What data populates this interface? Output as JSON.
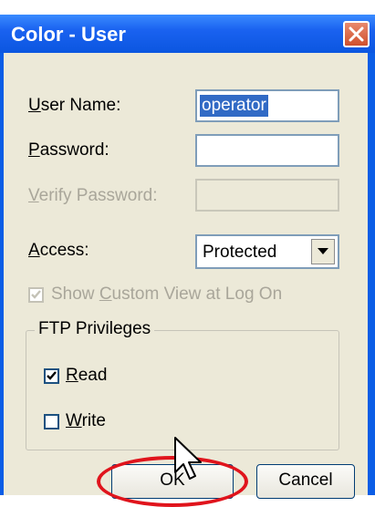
{
  "window": {
    "title": "Color - User",
    "colors": {
      "title_bar": "#1a62f0",
      "client_bg": "#ece9d8",
      "highlight_ring": "#e0141c"
    }
  },
  "form": {
    "user_name": {
      "label_prefix": "",
      "label_accel": "U",
      "label_rest": "ser Name:",
      "value": "operator"
    },
    "password": {
      "label_accel": "P",
      "label_rest": "assword:",
      "value": ""
    },
    "verify_password": {
      "label_accel": "V",
      "label_rest": "erify Password:",
      "value": ""
    },
    "access": {
      "label_accel": "A",
      "label_rest": "ccess:",
      "value": "Protected"
    },
    "show_custom_view": {
      "label_pre": "Show ",
      "label_accel": "C",
      "label_rest": "ustom View at Log On",
      "checked": true
    }
  },
  "ftp": {
    "legend": "FTP Privileges",
    "read": {
      "label_accel": "R",
      "label_rest": "ead",
      "checked": true
    },
    "write": {
      "label_accel": "W",
      "label_rest": "rite",
      "checked": false
    }
  },
  "buttons": {
    "ok": "OK",
    "cancel": "Cancel"
  },
  "icons": {
    "close": "close-icon",
    "dropdown": "chevron-down-icon",
    "cursor": "mouse-pointer-icon"
  }
}
